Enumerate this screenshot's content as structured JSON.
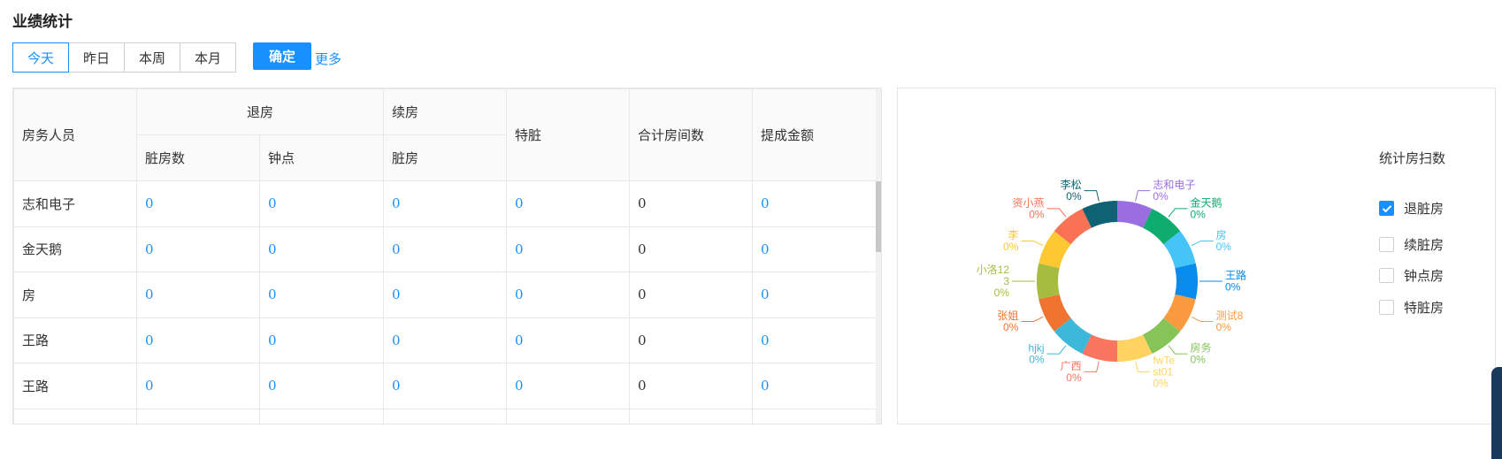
{
  "page": {
    "title": "业绩统计"
  },
  "filters": {
    "buttons": [
      "今天",
      "昨日",
      "本周",
      "本月"
    ],
    "active_index": 0,
    "confirm_label": "确定",
    "more_label": "更多"
  },
  "table": {
    "headers": {
      "staff": "房务人员",
      "checkout": "退房",
      "continue": "续房",
      "dirty_count": "脏房数",
      "hourly": "钟点",
      "continue_dirty": "脏房",
      "special_dirty": "特脏",
      "total_rooms": "合计房间数",
      "commission": "提成金额"
    },
    "rows": [
      {
        "name": "志和电子",
        "values": [
          "0",
          "0",
          "0",
          "0",
          "0",
          "0"
        ]
      },
      {
        "name": "金天鹅",
        "values": [
          "0",
          "0",
          "0",
          "0",
          "0",
          "0"
        ]
      },
      {
        "name": "房",
        "values": [
          "0",
          "0",
          "0",
          "0",
          "0",
          "0"
        ]
      },
      {
        "name": "王路",
        "values": [
          "0",
          "0",
          "0",
          "0",
          "0",
          "0"
        ]
      },
      {
        "name": "王路",
        "values": [
          "0",
          "0",
          "0",
          "0",
          "0",
          "0"
        ]
      }
    ]
  },
  "legend": {
    "title": "统计房扫数",
    "options": [
      {
        "label": "退脏房",
        "checked": true
      },
      {
        "label": "续脏房",
        "checked": false
      },
      {
        "label": "钟点房",
        "checked": false
      },
      {
        "label": "特脏房",
        "checked": false
      }
    ]
  },
  "chart_data": {
    "type": "pie",
    "donut": true,
    "slices": [
      {
        "label": "志和电子",
        "value": 0,
        "percent_label": "0%",
        "color": "#9a6ee0"
      },
      {
        "label": "金天鹅",
        "value": 0,
        "percent_label": "0%",
        "color": "#0eac6e"
      },
      {
        "label": "房",
        "value": 0,
        "percent_label": "0%",
        "color": "#45c4f7"
      },
      {
        "label": "王路",
        "value": 0,
        "percent_label": "0%",
        "color": "#078bec"
      },
      {
        "label": "测试8",
        "value": 0,
        "percent_label": "0%",
        "color": "#f99a3e"
      },
      {
        "label": "房务",
        "value": 0,
        "percent_label": "0%",
        "color": "#86c458"
      },
      {
        "label": "fwTest01",
        "label_lines": [
          "fwTe",
          "st01"
        ],
        "value": 0,
        "percent_label": "0%",
        "color": "#fed361"
      },
      {
        "label": "广西",
        "value": 0,
        "percent_label": "0%",
        "color": "#fa7560"
      },
      {
        "label": "hjkj",
        "value": 0,
        "percent_label": "0%",
        "color": "#3db8d8"
      },
      {
        "label": "张姐",
        "value": 0,
        "percent_label": "0%",
        "color": "#ef7430"
      },
      {
        "label": "小洛123",
        "label_lines": [
          "小洛12",
          "3"
        ],
        "value": 0,
        "percent_label": "0%",
        "color": "#a6bc40"
      },
      {
        "label": "李",
        "value": 0,
        "percent_label": "0%",
        "color": "#fdc831"
      },
      {
        "label": "资小燕",
        "value": 0,
        "percent_label": "0%",
        "color": "#fa7255"
      },
      {
        "label": "李松",
        "value": 0,
        "percent_label": "0%",
        "color": "#0e6271"
      }
    ]
  }
}
